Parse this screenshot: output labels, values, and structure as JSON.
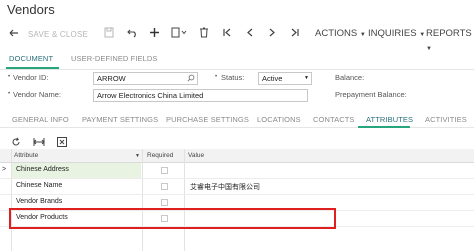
{
  "page": {
    "title": "Vendors"
  },
  "toolbar": {
    "save_close": "SAVE & CLOSE",
    "actions": "ACTIONS",
    "inquiries": "INQUIRIES",
    "reports": "REPORTS"
  },
  "doc_tabs": [
    {
      "label": "DOCUMENT",
      "active": true
    },
    {
      "label": "USER-DEFINED FIELDS",
      "active": false
    }
  ],
  "form": {
    "vendor_id": {
      "label": "Vendor ID:",
      "value": "ARROW"
    },
    "vendor_name": {
      "label": "Vendor Name:",
      "value": "Arrow Electronics China Limited"
    },
    "status": {
      "label": "Status:",
      "value": "Active"
    },
    "balance": {
      "label": "Balance:"
    },
    "prepayment_balance": {
      "label": "Prepayment Balance:"
    }
  },
  "sub_tabs": [
    {
      "label": "GENERAL INFO"
    },
    {
      "label": "PAYMENT SETTINGS"
    },
    {
      "label": "PURCHASE SETTINGS"
    },
    {
      "label": "LOCATIONS"
    },
    {
      "label": "CONTACTS"
    },
    {
      "label": "ATTRIBUTES",
      "active": true
    },
    {
      "label": "ACTIVITIES"
    }
  ],
  "grid": {
    "columns": {
      "attribute": "Attribute",
      "required": "Required",
      "value": "Value"
    },
    "rows": [
      {
        "attribute": "Chinese Address",
        "value": "",
        "required": false,
        "current": true
      },
      {
        "attribute": "Chinese Name",
        "value": "艾睿电子中国有限公司",
        "required": false
      },
      {
        "attribute": "Vendor Brands",
        "value": "",
        "required": false
      },
      {
        "attribute": "Vendor Products",
        "value": "",
        "required": false
      }
    ]
  },
  "colors": {
    "accent": "#27a67d",
    "highlight": "#e02020",
    "selected_row": "#e8f3e2"
  }
}
